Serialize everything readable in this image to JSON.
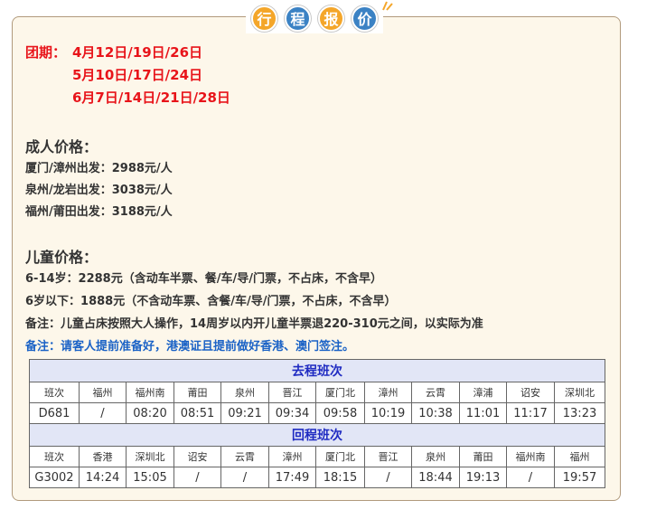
{
  "title_chars": [
    "行",
    "程",
    "报",
    "价"
  ],
  "dates": {
    "label": "团期：",
    "line1": "4月12日/19日/26日",
    "line2": "5月10日/17日/24日",
    "line3": "6月7日/14日/21日/28日"
  },
  "adult": {
    "heading": "成人价格：",
    "lines": [
      "厦门/漳州出发：2988元/人",
      "泉州/龙岩出发：3038元/人",
      "福州/莆田出发：3188元/人"
    ]
  },
  "child": {
    "heading": "儿童价格：",
    "lines": [
      "6-14岁：2288元（含动车半票、餐/车/导/门票，不占床，不含早）",
      "6岁以下：1888元（不含动车票、含餐/车/导/门票，不占床，不含早）",
      "备注：儿童占床按照大人操作，14周岁以内开儿童半票退220-310元之间，以实际为准"
    ],
    "note": "备注：请客人提前准备好，港澳证且提前做好香港、澳门签注。"
  },
  "schedule": {
    "outbound": {
      "title": "去程班次",
      "headers": [
        "班次",
        "福州",
        "福州南",
        "莆田",
        "泉州",
        "晋江",
        "厦门北",
        "漳州",
        "云霄",
        "漳浦",
        "诏安",
        "深圳北"
      ],
      "row": [
        "D681",
        "/",
        "08:20",
        "08:51",
        "09:21",
        "09:34",
        "09:58",
        "10:19",
        "10:38",
        "11:01",
        "11:17",
        "13:23"
      ]
    },
    "return": {
      "title": "回程班次",
      "headers": [
        "班次",
        "香港",
        "深圳北",
        "诏安",
        "云霄",
        "漳州",
        "厦门北",
        "晋江",
        "泉州",
        "莆田",
        "福州南",
        "福州"
      ],
      "row": [
        "G3002",
        "14:24",
        "15:05",
        "/",
        "/",
        "17:49",
        "18:15",
        "/",
        "18:44",
        "19:13",
        "/",
        "19:57"
      ]
    }
  },
  "colors": {
    "red": "#e8141a",
    "blue_note": "#1a62c6",
    "section_bg": "#e2e6f6",
    "title_orange": "#f4a62a",
    "title_blue": "#3b82c4"
  }
}
